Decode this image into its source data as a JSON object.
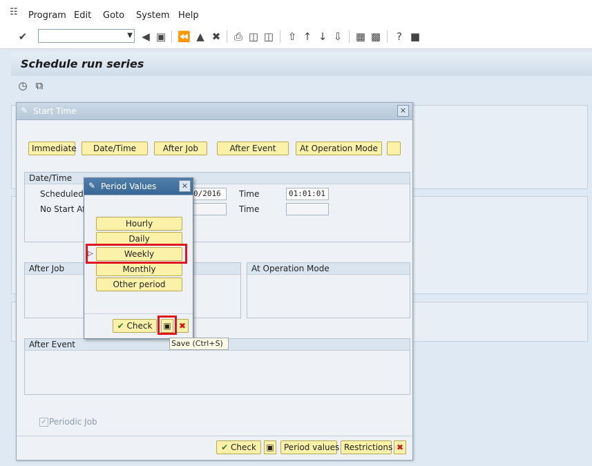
{
  "menu": {
    "items": [
      "Program",
      "Edit",
      "Goto",
      "System",
      "Help"
    ]
  },
  "toolbar": {
    "command_value": "",
    "icons": [
      "enter-icon",
      "back-arrow-icon",
      "save-icon",
      "back-icon",
      "exit-icon",
      "cancel-icon",
      "print-icon",
      "find-icon",
      "find-next-icon",
      "first-page-icon",
      "previous-page-icon",
      "next-page-icon",
      "last-page-icon",
      "create-session-icon",
      "shortcut-icon",
      "help-icon",
      "customize-layout-icon"
    ]
  },
  "page": {
    "title": "Schedule run series"
  },
  "start_dialog": {
    "title": "Start Time",
    "buttons": [
      "Immediate",
      "Date/Time",
      "After Job",
      "After Event",
      "At Operation Mode",
      ""
    ],
    "datetime_group": {
      "title": "Date/Time",
      "scheduled_label": "Scheduled S",
      "scheduled_date": "0/2016",
      "time_label": "Time",
      "time_value": "01:01:01",
      "no_start_label": "No Start Af",
      "no_start_date": "",
      "time_label_2": "Time",
      "no_start_time": ""
    },
    "after_job_group": {
      "title": "After Job"
    },
    "op_mode_group": {
      "title": "At Operation Mode"
    },
    "after_event_group": {
      "title": "After Event"
    },
    "periodic_job_label": "Periodic Job",
    "periodic_job_checked": true,
    "footer": {
      "check_label": "Check",
      "period_values_label": "Period values",
      "restrictions_label": "Restrictions"
    }
  },
  "period_dialog": {
    "title": "Period Values",
    "options": [
      "Hourly",
      "Daily",
      "Weekly",
      "Monthly",
      "Other period"
    ],
    "selected": "Weekly",
    "check_label": "Check"
  },
  "tooltip": {
    "text": "Save   (Ctrl+S)"
  },
  "colors": {
    "button_yellow": "#fbf1a8",
    "highlight_red": "#e0161e",
    "title_blue": "#3a6895"
  }
}
